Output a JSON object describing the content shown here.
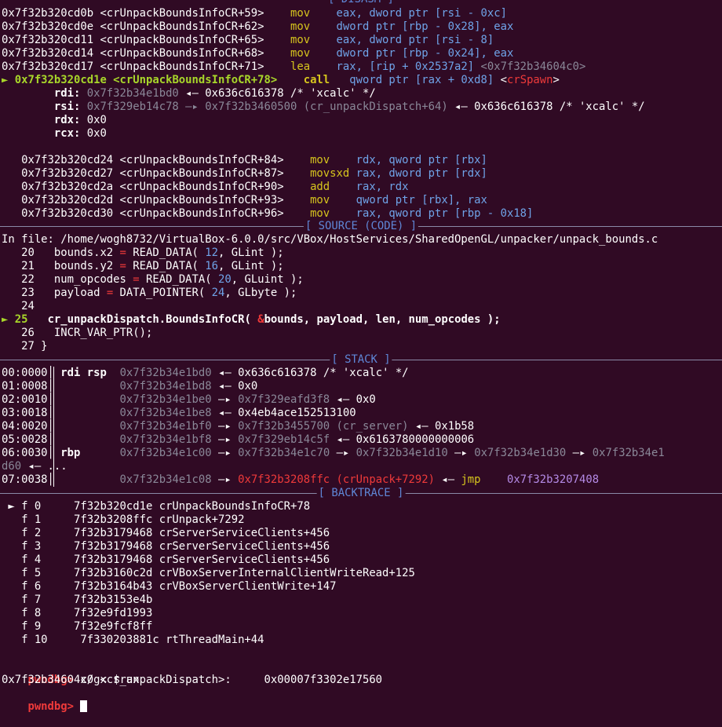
{
  "colors": {
    "background": "#300a24",
    "address": "#a8d62a",
    "mnemonic": "#d6c51d",
    "operand": "#6fa3e8",
    "dim": "#8a8898",
    "red": "#ef3a3a",
    "purple": "#b48ae6",
    "orange": "#d78a1f",
    "header": "#5f87d7"
  },
  "headers": {
    "disasm": "[ DISASM ]",
    "source": "[ SOURCE (CODE) ]",
    "stack": "[ STACK ]",
    "backtrace": "[ BACKTRACE ]"
  },
  "disasm": [
    [
      [
        "c-white",
        "0x7f32b320cd0b <crUnpackBoundsInfoCR+59>    "
      ],
      [
        "c-yellow",
        "mov    "
      ],
      [
        "c-blue",
        "eax, dword ptr [rsi - 0xc]"
      ]
    ],
    [
      [
        "c-white",
        "0x7f32b320cd0e <crUnpackBoundsInfoCR+62>    "
      ],
      [
        "c-yellow",
        "mov    "
      ],
      [
        "c-blue",
        "dword ptr [rbp - 0x28], eax"
      ]
    ],
    [
      [
        "c-white",
        "0x7f32b320cd11 <crUnpackBoundsInfoCR+65>    "
      ],
      [
        "c-yellow",
        "mov    "
      ],
      [
        "c-blue",
        "eax, dword ptr [rsi - 8]"
      ]
    ],
    [
      [
        "c-white",
        "0x7f32b320cd14 <crUnpackBoundsInfoCR+68>    "
      ],
      [
        "c-yellow",
        "mov    "
      ],
      [
        "c-blue",
        "dword ptr [rbp - 0x24], eax"
      ]
    ],
    [
      [
        "c-white",
        "0x7f32b320cd17 <crUnpackBoundsInfoCR+71>    "
      ],
      [
        "c-yellow",
        "lea    "
      ],
      [
        "c-blue",
        "rax, [rip + 0x2537a2] "
      ],
      [
        "c-gray",
        "<0x7f32b34604c0>"
      ]
    ],
    [
      [
        "c-green",
        "► "
      ],
      [
        "c-green-b",
        "0x7f32b320cd1e <crUnpackBoundsInfoCR+78>    "
      ],
      [
        "c-yellow c-bold",
        "call   "
      ],
      [
        "c-blue",
        "qword ptr [rax + 0xd8] "
      ],
      [
        "c-white",
        "<"
      ],
      [
        "c-red",
        "crSpawn"
      ],
      [
        "c-white",
        ">"
      ]
    ],
    [
      [
        "c-white c-bold",
        "        rdi: "
      ],
      [
        "c-gray",
        "0x7f32b34e1bd0"
      ],
      [
        "c-white",
        " ◂— 0x636c616378 /* 'xcalc' */"
      ]
    ],
    [
      [
        "c-white c-bold",
        "        rsi: "
      ],
      [
        "c-gray",
        "0x7f329eb14c78 —▸ 0x7f32b3460500 (cr_unpackDispatch+64)"
      ],
      [
        "c-white",
        " ◂— 0x636c616378 /* 'xcalc' */"
      ]
    ],
    [
      [
        "c-white c-bold",
        "        rdx: "
      ],
      [
        "c-white",
        "0x0"
      ]
    ],
    [
      [
        "c-white c-bold",
        "        rcx: "
      ],
      [
        "c-white",
        "0x0"
      ]
    ],
    [
      [
        "c-white",
        ""
      ]
    ],
    [
      [
        "c-white",
        "   0x7f32b320cd24 <crUnpackBoundsInfoCR+84>    "
      ],
      [
        "c-yellow",
        "mov    "
      ],
      [
        "c-blue",
        "rdx, qword ptr [rbx]"
      ]
    ],
    [
      [
        "c-white",
        "   0x7f32b320cd27 <crUnpackBoundsInfoCR+87>    "
      ],
      [
        "c-yellow",
        "movsxd "
      ],
      [
        "c-blue",
        "rax, dword ptr [rdx]"
      ]
    ],
    [
      [
        "c-white",
        "   0x7f32b320cd2a <crUnpackBoundsInfoCR+90>    "
      ],
      [
        "c-yellow",
        "add    "
      ],
      [
        "c-blue",
        "rax, rdx"
      ]
    ],
    [
      [
        "c-white",
        "   0x7f32b320cd2d <crUnpackBoundsInfoCR+93>    "
      ],
      [
        "c-yellow",
        "mov    "
      ],
      [
        "c-blue",
        "qword ptr [rbx], rax"
      ]
    ],
    [
      [
        "c-white",
        "   0x7f32b320cd30 <crUnpackBoundsInfoCR+96>    "
      ],
      [
        "c-yellow",
        "mov    "
      ],
      [
        "c-blue",
        "rax, qword ptr [rbp - 0x18]"
      ]
    ]
  ],
  "source": {
    "file": "In file: /home/wogh8732/VirtualBox-6.0.0/src/VBox/HostServices/SharedOpenGL/unpacker/unpack_bounds.c",
    "lines": [
      [
        [
          "c-white",
          "   20   bounds.x2 "
        ],
        [
          "c-red",
          "="
        ],
        [
          "c-white",
          " READ_DATA( "
        ],
        [
          "c-blue",
          "12"
        ],
        [
          "c-white",
          ", GLint );"
        ]
      ],
      [
        [
          "c-white",
          "   21   bounds.y2 "
        ],
        [
          "c-red",
          "="
        ],
        [
          "c-white",
          " READ_DATA( "
        ],
        [
          "c-blue",
          "16"
        ],
        [
          "c-white",
          ", GLint );"
        ]
      ],
      [
        [
          "c-white",
          "   22   num_opcodes "
        ],
        [
          "c-red",
          "="
        ],
        [
          "c-white",
          " READ_DATA( "
        ],
        [
          "c-blue",
          "20"
        ],
        [
          "c-white",
          ", GLuint );"
        ]
      ],
      [
        [
          "c-white",
          "   23   payload "
        ],
        [
          "c-red",
          "="
        ],
        [
          "c-white",
          " DATA_POINTER( "
        ],
        [
          "c-blue",
          "24"
        ],
        [
          "c-white",
          ", GLbyte );"
        ]
      ],
      [
        [
          "c-white",
          "   24"
        ]
      ],
      [
        [
          "c-green",
          "► "
        ],
        [
          "c-green-b",
          "25   "
        ],
        [
          "c-white c-bold",
          "cr_unpackDispatch.BoundsInfoCR( "
        ],
        [
          "c-redb",
          "&"
        ],
        [
          "c-white c-bold",
          "bounds, payload, len, num_opcodes );"
        ]
      ],
      [
        [
          "c-white",
          "   26   INCR_VAR_PTR();"
        ]
      ],
      [
        [
          "c-white",
          "   27 }"
        ]
      ]
    ]
  },
  "stack": [
    [
      [
        "c-white",
        "00:0000│ "
      ],
      [
        "c-white c-bold",
        "rdi rsp  "
      ],
      [
        "c-gray",
        "0x7f32b34e1bd0"
      ],
      [
        "c-white",
        " ◂— 0x636c616378 /* 'xcalc' */"
      ]
    ],
    [
      [
        "c-white",
        "01:0008│          "
      ],
      [
        "c-gray",
        "0x7f32b34e1bd8"
      ],
      [
        "c-white",
        " ◂— 0x0"
      ]
    ],
    [
      [
        "c-white",
        "02:0010│          "
      ],
      [
        "c-gray",
        "0x7f32b34e1be0"
      ],
      [
        "c-white",
        " —▸ "
      ],
      [
        "c-gray",
        "0x7f329eafd3f8"
      ],
      [
        "c-white",
        " ◂— 0x0"
      ]
    ],
    [
      [
        "c-white",
        "03:0018│          "
      ],
      [
        "c-gray",
        "0x7f32b34e1be8"
      ],
      [
        "c-white",
        " ◂— 0x4eb4ace152513100"
      ]
    ],
    [
      [
        "c-white",
        "04:0020│          "
      ],
      [
        "c-gray",
        "0x7f32b34e1bf0"
      ],
      [
        "c-white",
        " —▸ "
      ],
      [
        "c-gray",
        "0x7f32b3455700 (cr_server)"
      ],
      [
        "c-white",
        " ◂— 0x1b58"
      ]
    ],
    [
      [
        "c-white",
        "05:0028│          "
      ],
      [
        "c-gray",
        "0x7f32b34e1bf8"
      ],
      [
        "c-white",
        " —▸ "
      ],
      [
        "c-gray",
        "0x7f329eb14c5f"
      ],
      [
        "c-white",
        " ◂— 0x6163780000000006"
      ]
    ],
    [
      [
        "c-white",
        "06:0030│ "
      ],
      [
        "c-white c-bold",
        "rbp      "
      ],
      [
        "c-gray",
        "0x7f32b34e1c00"
      ],
      [
        "c-white",
        " —▸ "
      ],
      [
        "c-gray",
        "0x7f32b34e1c70"
      ],
      [
        "c-white",
        " —▸ "
      ],
      [
        "c-gray",
        "0x7f32b34e1d10"
      ],
      [
        "c-white",
        " —▸ "
      ],
      [
        "c-gray",
        "0x7f32b34e1d30"
      ],
      [
        "c-white",
        " —▸ "
      ],
      [
        "c-gray",
        "0x7f32b34e1"
      ]
    ],
    [
      [
        "c-gray",
        "d60"
      ],
      [
        "c-white",
        " ◂— ..."
      ]
    ],
    [
      [
        "c-white",
        "07:0038│          "
      ],
      [
        "c-gray",
        "0x7f32b34e1c08"
      ],
      [
        "c-white",
        " —▸ "
      ],
      [
        "c-red",
        "0x7f32b3208ffc (crUnpack+7292)"
      ],
      [
        "c-white",
        " ◂— "
      ],
      [
        "c-yellow",
        "jmp    "
      ],
      [
        "c-purple",
        "0x7f32b3207408"
      ]
    ]
  ],
  "backtrace": [
    [
      [
        "c-white",
        " ► f 0     7f32b320cd1e crUnpackBoundsInfoCR+78"
      ]
    ],
    [
      [
        "c-white",
        "   f 1     7f32b3208ffc crUnpack+7292"
      ]
    ],
    [
      [
        "c-white",
        "   f 2     7f32b3179468 crServerServiceClients+456"
      ]
    ],
    [
      [
        "c-white",
        "   f 3     7f32b3179468 crServerServiceClients+456"
      ]
    ],
    [
      [
        "c-white",
        "   f 4     7f32b3179468 crServerServiceClients+456"
      ]
    ],
    [
      [
        "c-white",
        "   f 5     7f32b3160c2d crVBoxServerInternalClientWriteRead+125"
      ]
    ],
    [
      [
        "c-white",
        "   f 6     7f32b3164b43 crVBoxServerClientWrite+147"
      ]
    ],
    [
      [
        "c-white",
        "   f 7     7f32b3153e4b"
      ]
    ],
    [
      [
        "c-white",
        "   f 8     7f32e9fd1993"
      ]
    ],
    [
      [
        "c-white",
        "   f 9     7f32e9fcf8ff"
      ]
    ],
    [
      [
        "c-white",
        "   f 10     7f330203881c rtThreadMain+44"
      ]
    ]
  ],
  "prompt": {
    "name": "pwndbg>",
    "command": "x/gx $rax",
    "output": "0x7f32b34604c0 <cr_unpackDispatch>:     0x00007f3302e17560"
  }
}
